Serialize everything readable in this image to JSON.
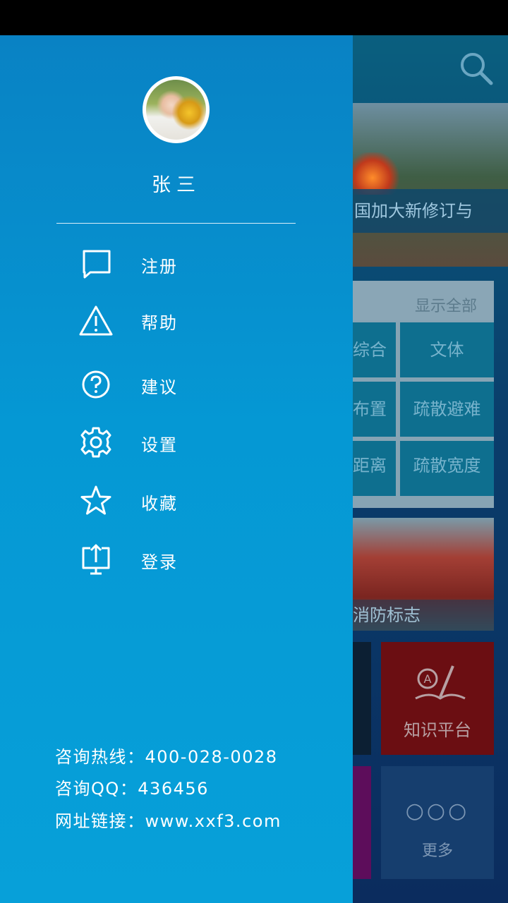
{
  "background": {
    "banner_caption": "国加大新修订与",
    "show_all_label": "显示全部",
    "categories": [
      {
        "label": "综合"
      },
      {
        "label": "文体"
      },
      {
        "label": "布置"
      },
      {
        "label": "疏散避难"
      },
      {
        "label": "距离"
      },
      {
        "label": "疏散宽度"
      }
    ],
    "photo_caption": "消防标志",
    "tiles": {
      "knowledge_label": "知识平台",
      "more_dots": "○○○",
      "more_label": "更多"
    }
  },
  "drawer": {
    "user_name": "张三",
    "menu": [
      {
        "label": "注册",
        "icon": "chat-bubble-icon"
      },
      {
        "label": "帮助",
        "icon": "warning-icon"
      },
      {
        "label": "建议",
        "icon": "question-icon"
      },
      {
        "label": "设置",
        "icon": "gear-icon"
      },
      {
        "label": "收藏",
        "icon": "star-icon"
      },
      {
        "label": "登录",
        "icon": "upload-monitor-icon"
      }
    ],
    "contact": {
      "hotline": "咨询热线：400-028-0028",
      "qq": "咨询QQ：436456",
      "website": "网址链接：www.xxf3.com"
    }
  },
  "colors": {
    "drawer_top": "#0982c4",
    "drawer_bottom": "#07a0d9",
    "text": "#ffffff"
  }
}
